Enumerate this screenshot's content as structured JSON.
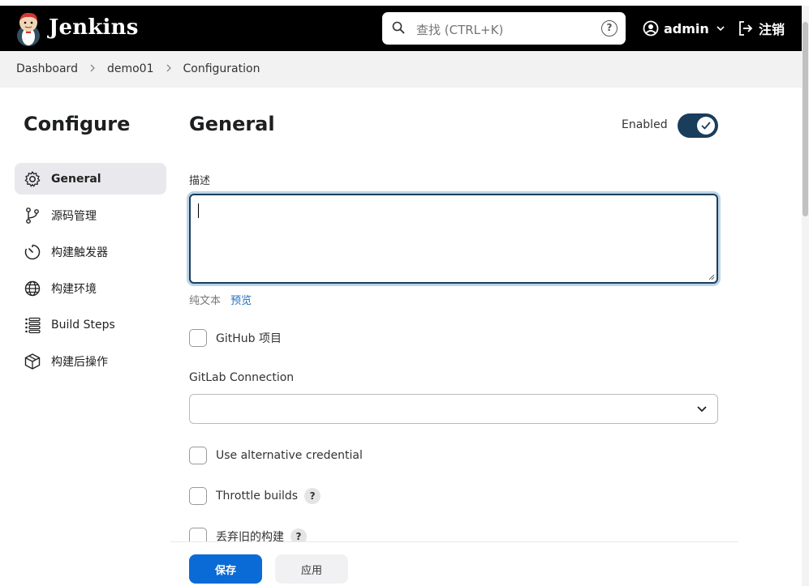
{
  "header": {
    "brand": "Jenkins",
    "search_placeholder": "查找 (CTRL+K)",
    "search_help": "?",
    "user": "admin",
    "logout": "注销"
  },
  "breadcrumb": [
    "Dashboard",
    "demo01",
    "Configuration"
  ],
  "sidebar": {
    "title": "Configure",
    "items": [
      {
        "label": "General",
        "icon": "gear-icon",
        "active": true
      },
      {
        "label": "源码管理",
        "icon": "branch-icon"
      },
      {
        "label": "构建触发器",
        "icon": "timer-icon"
      },
      {
        "label": "构建环境",
        "icon": "globe-icon"
      },
      {
        "label": "Build Steps",
        "icon": "list-icon"
      },
      {
        "label": "构建后操作",
        "icon": "package-icon"
      }
    ]
  },
  "main": {
    "title": "General",
    "enabled_label": "Enabled",
    "enabled": true,
    "description_label": "描述",
    "description_value": "",
    "plain_text": "纯文本",
    "preview": "预览",
    "github_project": "GitHub 项目",
    "gitlab_connection_label": "GitLab Connection",
    "gitlab_connection_value": "",
    "use_alt_credential": "Use alternative credential",
    "throttle_builds": "Throttle builds",
    "discard_old_builds": "丢弃旧的构建",
    "help": "?"
  },
  "actions": {
    "save": "保存",
    "apply": "应用"
  },
  "colors": {
    "accent": "#0b6bd6",
    "toggle": "#1a3d5c",
    "link": "#1c6fbf"
  }
}
